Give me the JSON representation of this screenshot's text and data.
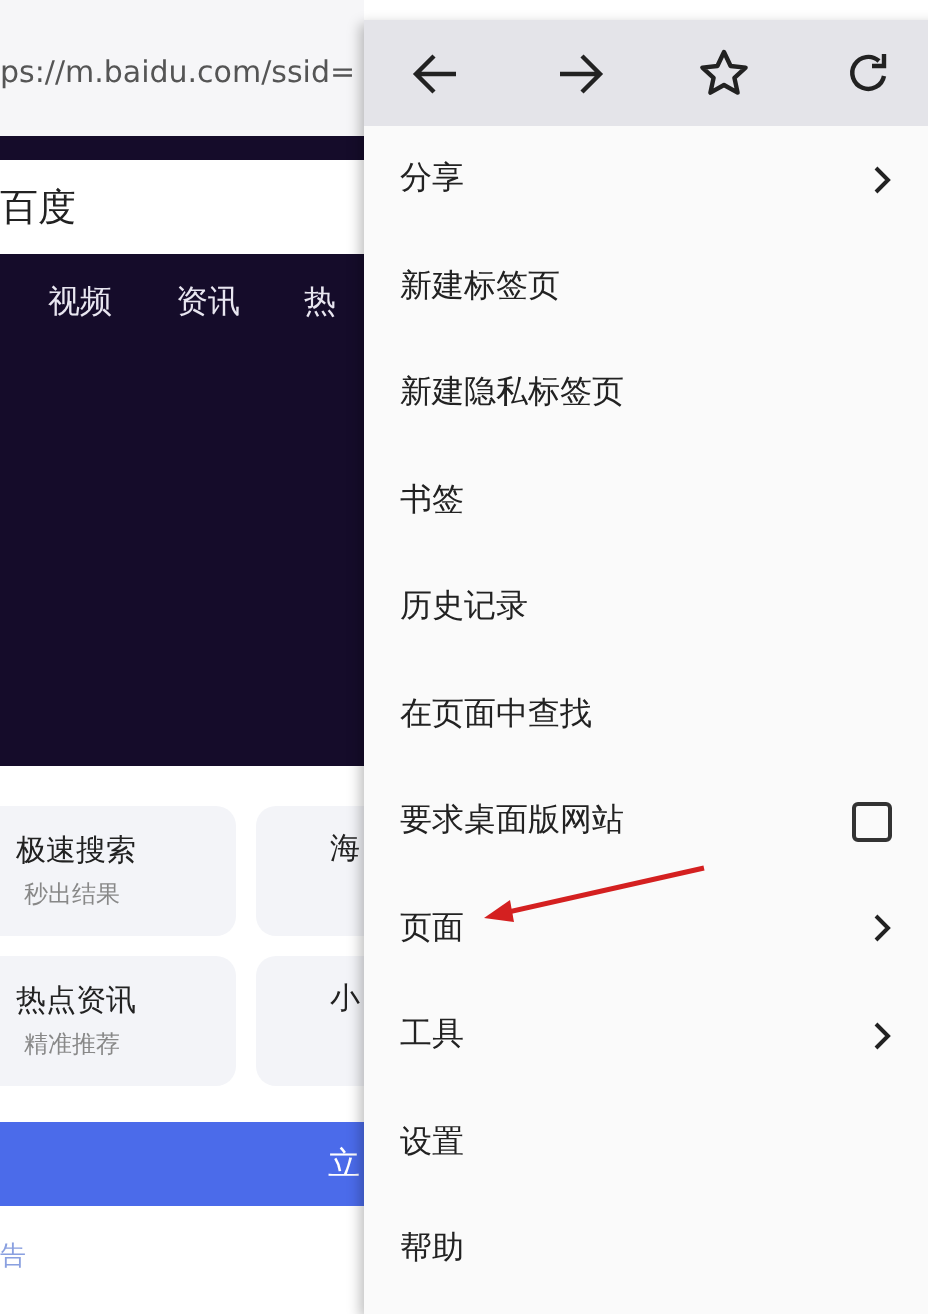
{
  "address_bar": {
    "url": "ps://m.baidu.com/ssid="
  },
  "page": {
    "search_box": {
      "value": "百度"
    },
    "nav_tabs": [
      "视频",
      "资讯",
      "热"
    ],
    "cards": [
      {
        "title": "极速搜索",
        "subtitle": "秒出结果"
      },
      {
        "title": "海"
      },
      {
        "title": "热点资讯",
        "subtitle": "精准推荐"
      },
      {
        "title": "小"
      }
    ],
    "cta_button": "立",
    "ad_label": "告"
  },
  "menu": {
    "toolbar": [
      {
        "kind": "back"
      },
      {
        "kind": "forward"
      },
      {
        "kind": "star"
      },
      {
        "kind": "reload"
      }
    ],
    "items": [
      {
        "label": "分享",
        "kind": "submenu"
      },
      {
        "label": "新建标签页",
        "kind": "plain"
      },
      {
        "label": "新建隐私标签页",
        "kind": "plain"
      },
      {
        "label": "书签",
        "kind": "plain"
      },
      {
        "label": "历史记录",
        "kind": "plain"
      },
      {
        "label": "在页面中查找",
        "kind": "plain"
      },
      {
        "label": "要求桌面版网站",
        "kind": "checkbox",
        "checked": false
      },
      {
        "label": "页面",
        "kind": "submenu"
      },
      {
        "label": "工具",
        "kind": "submenu"
      },
      {
        "label": "设置",
        "kind": "plain"
      },
      {
        "label": "帮助",
        "kind": "plain"
      }
    ]
  },
  "annotation": {
    "kind": "arrow"
  }
}
